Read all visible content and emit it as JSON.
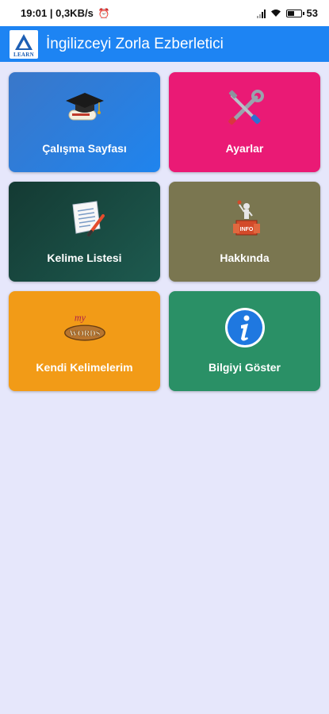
{
  "status_bar": {
    "time_net": "19:01 | 0,3KB/s",
    "battery": "53"
  },
  "app_bar": {
    "logo_text": "LEARN",
    "title": "İngilizceyi Zorla Ezberletici"
  },
  "tiles": [
    {
      "label": "Çalışma Sayfası",
      "icon": "graduation-cap-icon"
    },
    {
      "label": "Ayarlar",
      "icon": "tools-icon"
    },
    {
      "label": "Kelime Listesi",
      "icon": "document-list-icon"
    },
    {
      "label": "Hakkında",
      "icon": "about-figure-icon"
    },
    {
      "label": "Kendi Kelimelerim",
      "icon": "my-words-icon"
    },
    {
      "label": "Bilgiyi Göster",
      "icon": "info-icon"
    }
  ],
  "my_words_text": {
    "top": "my",
    "bottom": "WORDS"
  },
  "colors": {
    "app_bar": "#1d84f3",
    "background": "#e6e7fb",
    "tile_study": "#1f84ee",
    "tile_settings": "#ea1a75",
    "tile_wordlist": "#1d5a4f",
    "tile_about": "#7a7650",
    "tile_mywords": "#f29b17",
    "tile_info": "#2a9066"
  }
}
